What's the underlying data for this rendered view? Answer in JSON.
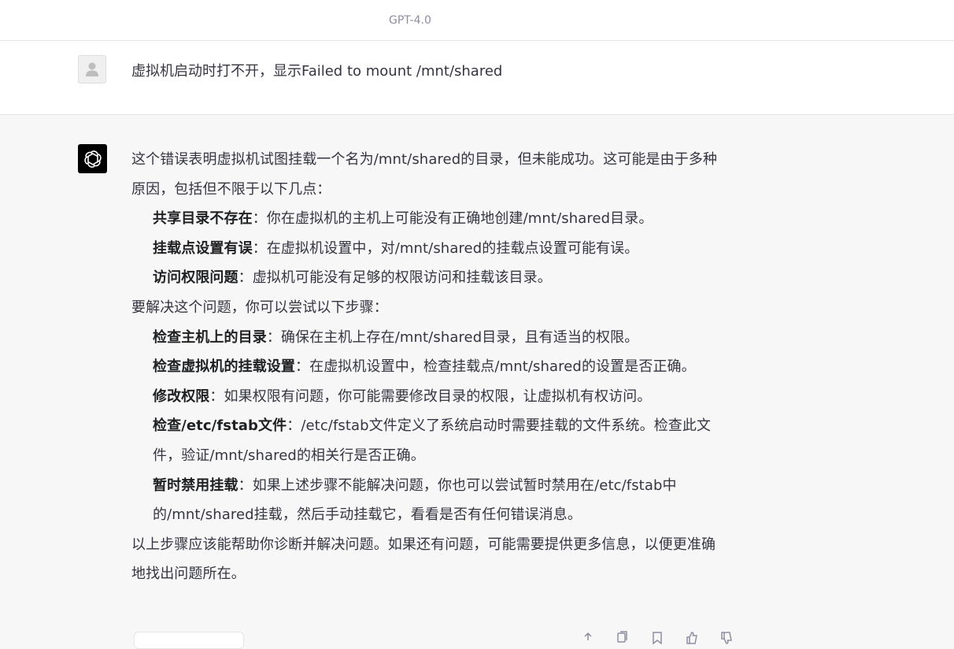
{
  "header": {
    "model_label": "GPT-4.0"
  },
  "user_message": {
    "avatar_icon": "user-icon",
    "text": "虚拟机启动时打不开，显示Failed to mount /mnt/shared"
  },
  "assistant_message": {
    "avatar_icon": "openai-logo-icon",
    "intro": "这个错误表明虚拟机试图挂载一个名为/mnt/shared的目录，但未能成功。这可能是由于多种原因，包括但不限于以下几点：",
    "causes": [
      {
        "title": "共享目录不存在",
        "text": "：你在虚拟机的主机上可能没有正确地创建/mnt/shared目录。"
      },
      {
        "title": "挂载点设置有误",
        "text": "：在虚拟机设置中，对/mnt/shared的挂载点设置可能有误。"
      },
      {
        "title": "访问权限问题",
        "text": "：虚拟机可能没有足够的权限访问和挂载该目录。"
      }
    ],
    "steps_intro": "要解决这个问题，你可以尝试以下步骤：",
    "steps": [
      {
        "title": "检查主机上的目录",
        "text": "：确保在主机上存在/mnt/shared目录，且有适当的权限。"
      },
      {
        "title": "检查虚拟机的挂载设置",
        "text": "：在虚拟机设置中，检查挂载点/mnt/shared的设置是否正确。"
      },
      {
        "title": "修改权限",
        "text": "：如果权限有问题，你可能需要修改目录的权限，让虚拟机有权访问。"
      },
      {
        "title": "检查/etc/fstab文件",
        "text": "：/etc/fstab文件定义了系统启动时需要挂载的文件系统。检查此文件，验证/mnt/shared的相关行是否正确。"
      },
      {
        "title": "暂时禁用挂载",
        "text": "：如果上述步骤不能解决问题，你也可以尝试暂时禁用在/etc/fstab中的/mnt/shared挂载，然后手动挂载它，看看是否有任何错误消息。"
      }
    ],
    "closing": "以上步骤应该能帮助你诊断并解决问题。如果还有问题，可能需要提供更多信息，以便更准确地找出问题所在。"
  },
  "actions": {
    "icons": [
      "share-icon",
      "copy-icon",
      "bookmark-icon",
      "thumbs-up-icon",
      "thumbs-down-icon"
    ]
  }
}
